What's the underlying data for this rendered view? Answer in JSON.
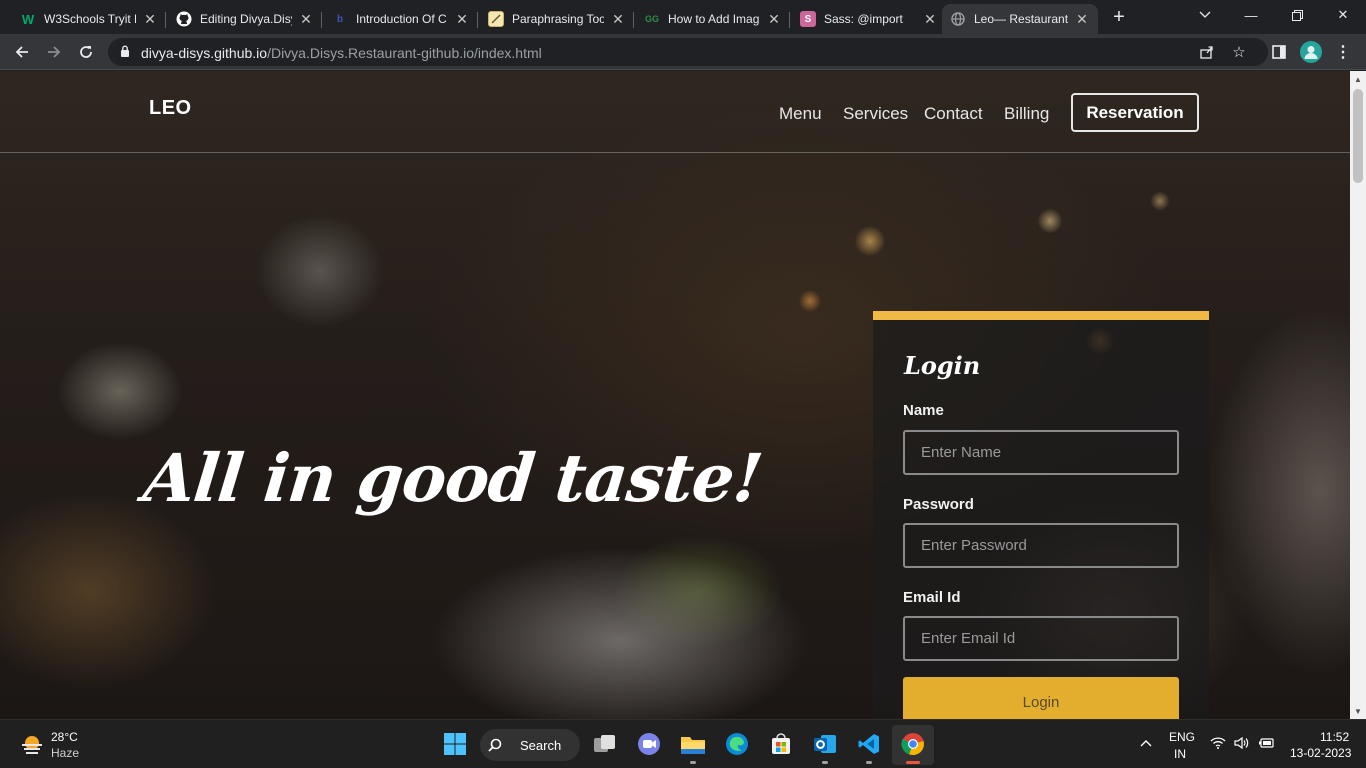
{
  "browser": {
    "tabs": [
      {
        "title": "W3Schools Tryit E",
        "icon": "w3schools-icon",
        "icon_char": "W",
        "icon_color": "#04aa6d"
      },
      {
        "title": "Editing Divya.Disy",
        "icon": "github-icon",
        "icon_char": "",
        "icon_color": "#ffffff"
      },
      {
        "title": "Introduction Of C",
        "icon": "site-icon",
        "icon_char": "b",
        "icon_color": "#1a237e"
      },
      {
        "title": "Paraphrasing Too",
        "icon": "quill-icon",
        "icon_char": "",
        "icon_color": "#f3e7b4"
      },
      {
        "title": "How to Add Imag",
        "icon": "gfg-icon",
        "icon_char": "GG",
        "icon_color": "#2f8d46"
      },
      {
        "title": "Sass: @import",
        "icon": "sass-icon",
        "icon_char": "S",
        "icon_color": "#cd6799"
      },
      {
        "title": "Leo— Restaurant",
        "icon": "globe-icon",
        "icon_char": "",
        "icon_color": "#9aa0a6"
      }
    ],
    "active_tab_index": 6,
    "url_host": "divya-disys.github.io",
    "url_path": "/Divya.Disys.Restaurant-github.io/index.html"
  },
  "site": {
    "logo": "LEO",
    "nav": [
      "Menu",
      "Services",
      "Contact",
      "Billing"
    ],
    "reservation_label": "Reservation",
    "hero_text": "All in good taste!",
    "accent_color": "#f0b845",
    "login": {
      "title": "Login",
      "name_label": "Name",
      "name_placeholder": "Enter Name",
      "password_label": "Password",
      "password_placeholder": "Enter Password",
      "email_label": "Email Id",
      "email_placeholder": "Enter Email Id",
      "button_label": "Login",
      "button_color": "#e3ae2d"
    }
  },
  "taskbar": {
    "weather_temp": "28°C",
    "weather_desc": "Haze",
    "search_label": "Search",
    "apps": [
      "windows-start-icon",
      "task-view-icon",
      "teams-icon",
      "file-explorer-icon",
      "edge-icon",
      "store-icon",
      "outlook-icon",
      "vscode-icon",
      "chrome-icon"
    ],
    "lang_top": "ENG",
    "lang_bottom": "IN",
    "time": "11:52",
    "date": "13-02-2023"
  }
}
